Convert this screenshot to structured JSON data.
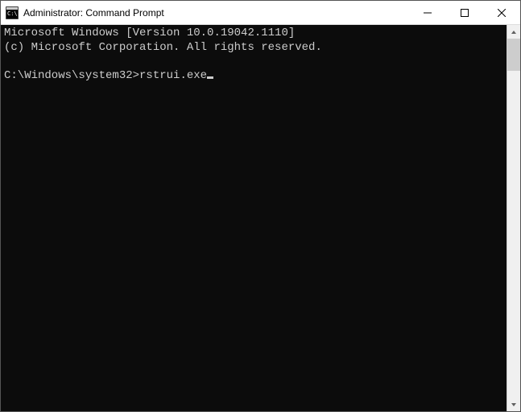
{
  "titlebar": {
    "title": "Administrator: Command Prompt"
  },
  "terminal": {
    "line1": "Microsoft Windows [Version 10.0.19042.1110]",
    "line2": "(c) Microsoft Corporation. All rights reserved.",
    "prompt_path": "C:\\Windows\\system32>",
    "command": "rstrui.exe"
  }
}
